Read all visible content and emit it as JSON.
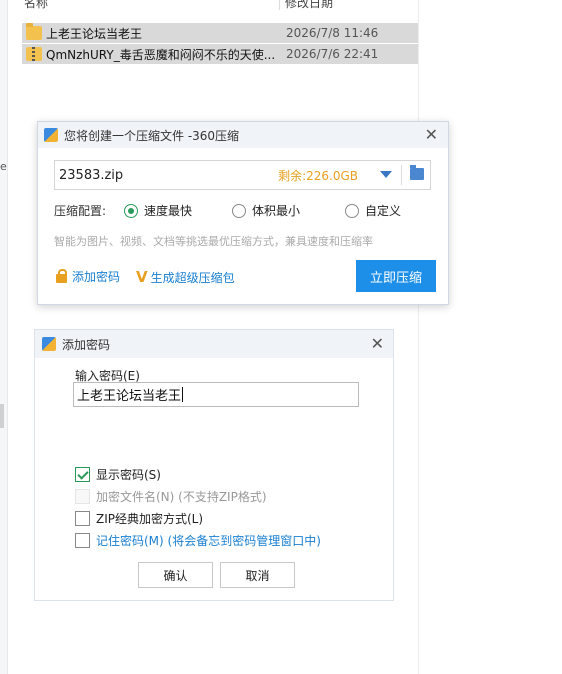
{
  "explorer": {
    "columns": {
      "name": "名称",
      "date": "修改日期"
    },
    "files": [
      {
        "name": "上老王论坛当老王",
        "date": "2026/7/8 11:46",
        "type": "folder"
      },
      {
        "name": "QmNzhURY_毒舌恶魔和闷闷不乐的天使...",
        "date": "2026/7/6 22:41",
        "type": "zip"
      }
    ],
    "left_mark": "e"
  },
  "compress_dialog": {
    "title": "您将创建一个压缩文件 -360压缩",
    "filename": "23583.zip",
    "free_space": "剩余:226.0GB",
    "config_label": "压缩配置:",
    "options": [
      {
        "label": "速度最快",
        "selected": true
      },
      {
        "label": "体积最小",
        "selected": false
      },
      {
        "label": "自定义",
        "selected": false
      }
    ],
    "hint": "智能为图片、视频、文档等挑选最优压缩方式，兼具速度和压缩率",
    "add_password_link": "添加密码",
    "super_package_link": "生成超级压缩包",
    "compress_button": "立即压缩",
    "accent_color": "#1e8fe8"
  },
  "password_dialog": {
    "title": "添加密码",
    "input_label": "输入密码(E)",
    "password_value": "上老王论坛当老王",
    "options": [
      {
        "label": "显示密码(S)",
        "checked": true,
        "disabled": false
      },
      {
        "label": "加密文件名(N) (不支持ZIP格式)",
        "checked": false,
        "disabled": true
      },
      {
        "label": "ZIP经典加密方式(L)",
        "checked": false,
        "disabled": false
      },
      {
        "label": "记住密码(M) (将会备忘到密码管理窗口中)",
        "checked": false,
        "disabled": false
      }
    ],
    "ok_button": "确认",
    "cancel_button": "取消"
  }
}
